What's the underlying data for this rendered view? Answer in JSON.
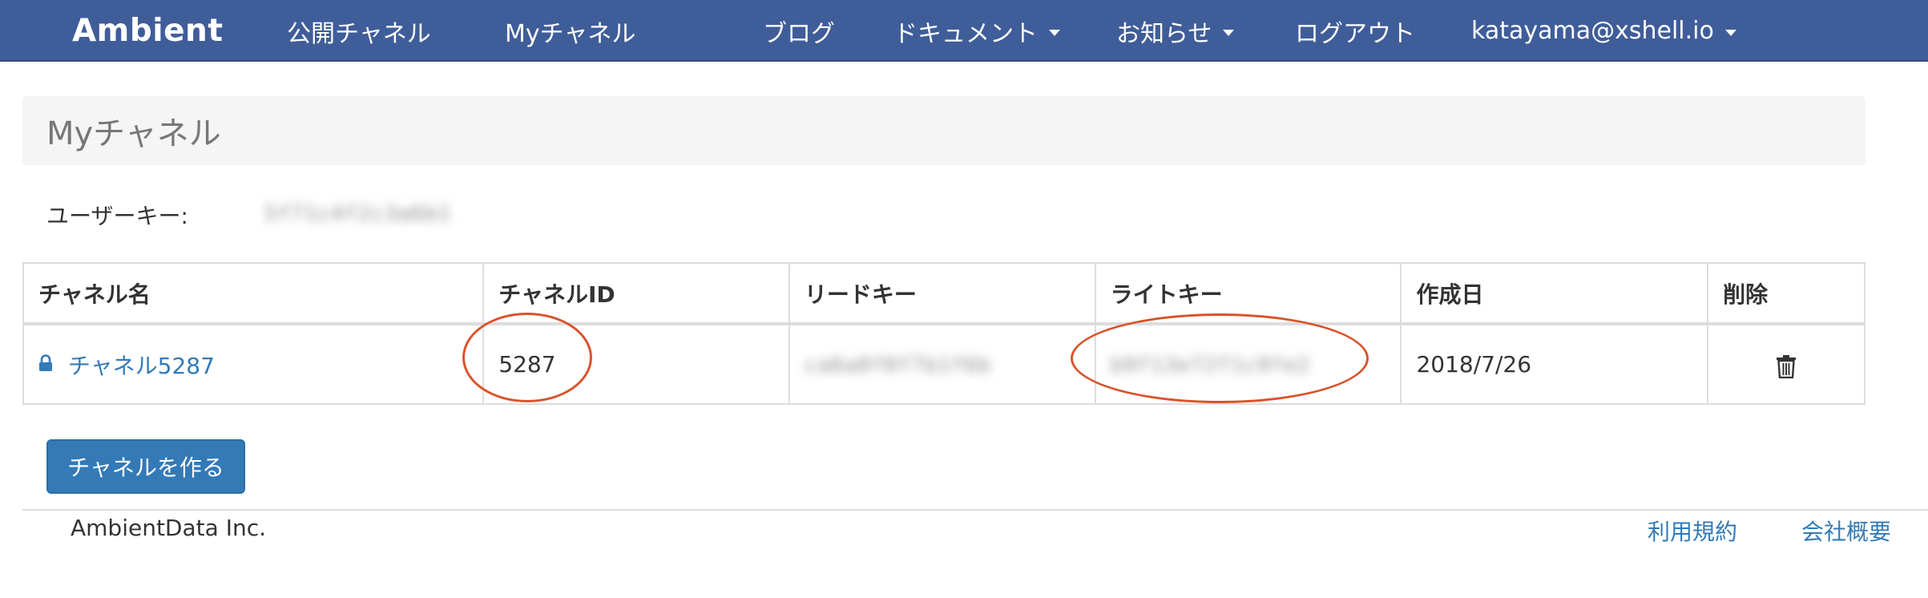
{
  "navbar": {
    "brand": "Ambient",
    "items": [
      {
        "label": "公開チャネル"
      },
      {
        "label": "Myチャネル"
      },
      {
        "label": "ブログ"
      },
      {
        "label": "ドキュメント"
      },
      {
        "label": "お知らせ"
      },
      {
        "label": "ログアウト"
      },
      {
        "label": "katayama@xshell.io"
      }
    ],
    "background_color": "#3f5d99"
  },
  "page": {
    "title": "Myチャネル",
    "user_key_label": "ユーザーキー:",
    "user_key_value": "5f71c4f2c3a6b1"
  },
  "table": {
    "headers": [
      "チャネル名",
      "チャネルID",
      "リードキー",
      "ライトキー",
      "作成日",
      "削除"
    ],
    "rows": [
      {
        "name": "チャネル5287",
        "channel_id": "5287",
        "read_key": "ca6a0f0f7b1f6b",
        "write_key": "b9f13e72f1c9fe2",
        "created": "2018/7/26",
        "delete_icon": "trash-icon",
        "lock_icon": "lock-icon"
      }
    ]
  },
  "actions": {
    "create_channel": "チャネルを作る"
  },
  "footer": {
    "company": "AmbientData Inc.",
    "links": [
      "利用規約",
      "会社概要"
    ]
  },
  "colors": {
    "link": "#337ab7",
    "primary_button": "#337ab7",
    "annotation_circle": "#d9532b"
  }
}
